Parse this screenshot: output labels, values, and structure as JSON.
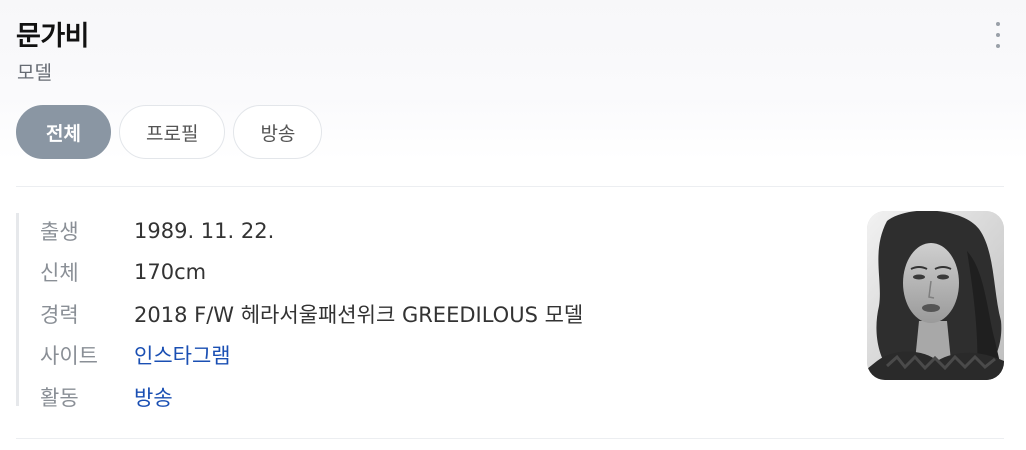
{
  "profile": {
    "name": "문가비",
    "occupation": "모델"
  },
  "tabs": [
    {
      "label": "전체",
      "active": true
    },
    {
      "label": "프로필",
      "active": false
    },
    {
      "label": "방송",
      "active": false
    }
  ],
  "info": [
    {
      "label": "출생",
      "value": "1989. 11. 22.",
      "link": false
    },
    {
      "label": "신체",
      "value": "170cm",
      "link": false
    },
    {
      "label": "경력",
      "value": "2018 F/W 헤라서울패션위크 GREEDILOUS 모델",
      "link": false
    },
    {
      "label": "사이트",
      "value": "인스타그램",
      "link": true
    },
    {
      "label": "활동",
      "value": "방송",
      "link": true
    }
  ],
  "colors": {
    "active_tab": "#8a96a3",
    "link": "#1a4fb3",
    "label": "#8a8f96"
  },
  "icons": {
    "more": "more-vertical-icon"
  }
}
